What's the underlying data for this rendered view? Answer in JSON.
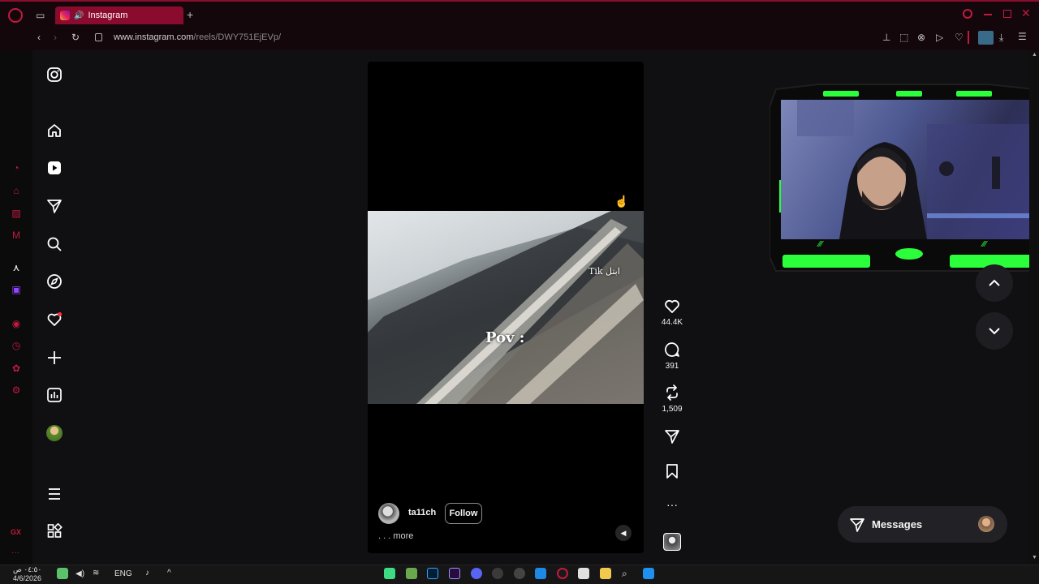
{
  "browser": {
    "tab_title": "Instagram",
    "url_host": "www.instagram.com",
    "url_path": "/reels/DWY751EjEVp/",
    "new_tab": "+"
  },
  "reel": {
    "overlay_pov": "Pov :",
    "overlay_tik": "Tik ابتل",
    "username": "ta11ch",
    "follow_label": "Follow",
    "more_label": ". . . more",
    "likes": "44.4K",
    "comments": "391",
    "reposts": "1,509"
  },
  "messages": {
    "label": "Messages"
  },
  "taskbar": {
    "time": "٠٤:٥٠ ص",
    "date": "4/6/2026",
    "lang": "ENG"
  },
  "opera": {
    "gx_label": "GX"
  },
  "colors": {
    "accent": "#8a0b2d",
    "opera_red": "#c2193f",
    "cam_green": "#2bff3b"
  }
}
